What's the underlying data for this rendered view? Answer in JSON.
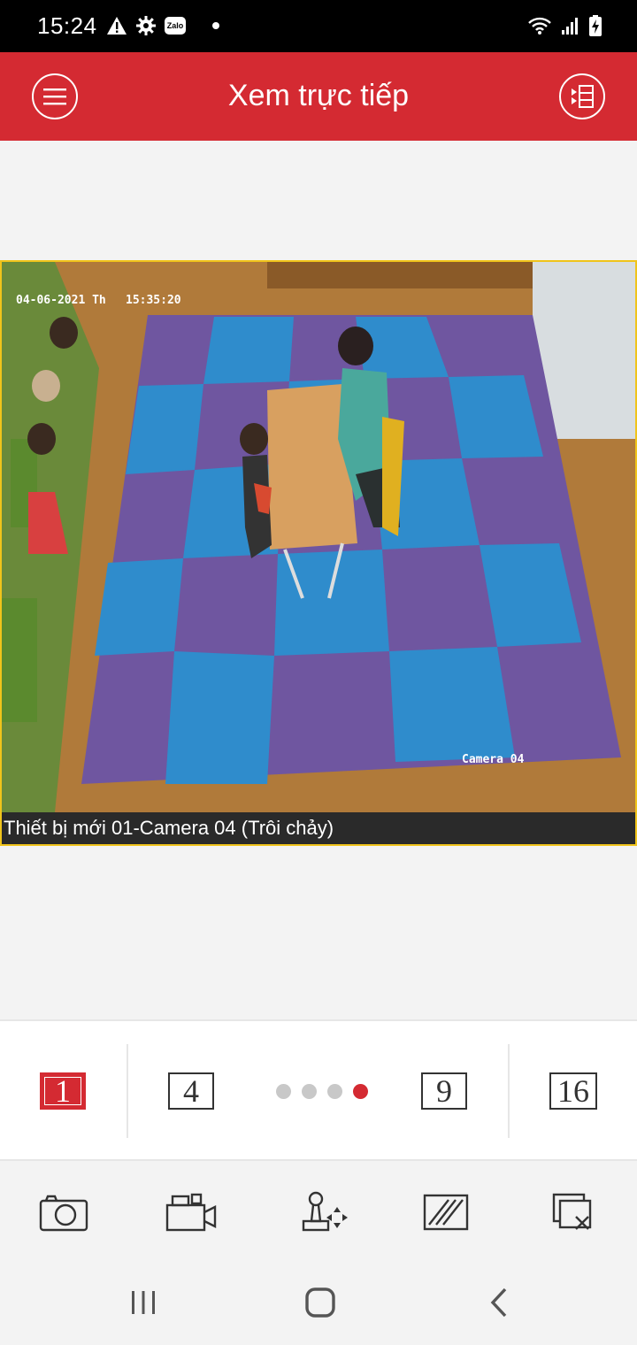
{
  "status_bar": {
    "time": "15:24",
    "icons_left": [
      "warning-icon",
      "settings-icon",
      "zalo-icon",
      "notification-dot"
    ],
    "zalo_label": "Zalo",
    "icons_right": [
      "wifi-icon",
      "signal-icon",
      "battery-charging-icon"
    ]
  },
  "app_bar": {
    "title": "Xem trực tiếp",
    "menu_icon": "hamburger-menu-icon",
    "layout_icon": "channel-list-icon",
    "color": "#d42a32"
  },
  "video": {
    "osd_date": "04-06-2021 Th",
    "osd_time": "15:35:20",
    "osd_camera": "Camera 04",
    "caption": "Thiết bị mới 01-Camera 04 (Trôi chảy)",
    "border_color": "#f0c41b"
  },
  "split_bar": {
    "options": [
      "1",
      "4",
      "9",
      "16"
    ],
    "active_option": "1",
    "page_dots_total": 4,
    "page_dots_active_index": 3
  },
  "toolbar": {
    "buttons": [
      "camera-snapshot-icon",
      "video-record-icon",
      "ptz-joystick-icon",
      "image-quality-icon",
      "close-all-icon"
    ]
  },
  "nav_bar": {
    "buttons": [
      "recent-apps-icon",
      "home-icon",
      "back-icon"
    ]
  }
}
